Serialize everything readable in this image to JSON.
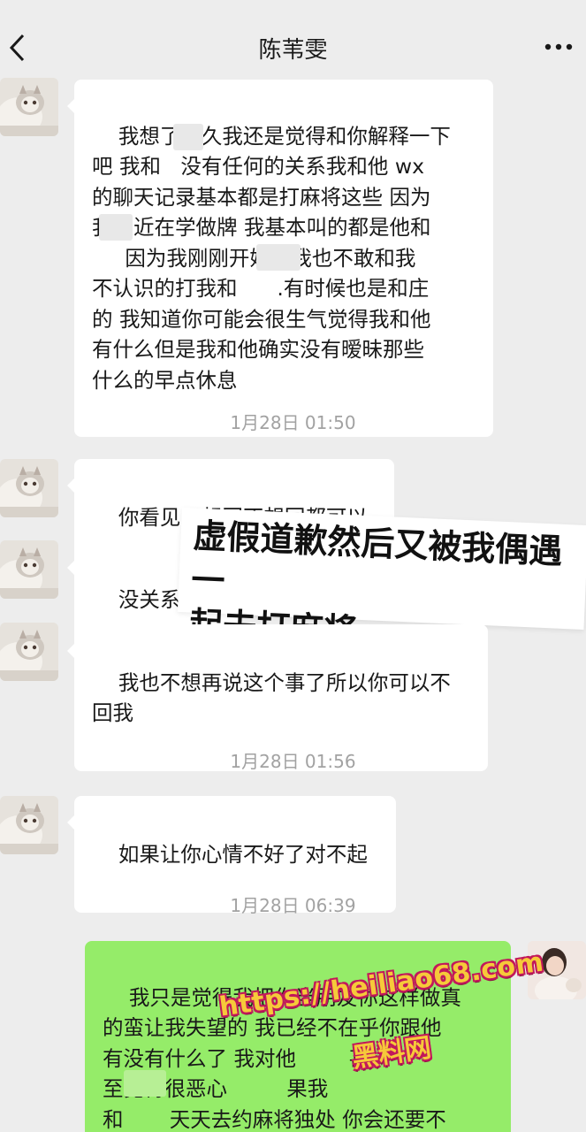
{
  "header": {
    "title": "陈苇雯",
    "back_icon": "chevron-left-icon",
    "more_icon": "more-dots-icon"
  },
  "messages": [
    {
      "direction": "in",
      "text": "我想了很久我还是觉得和你解释一下\n吧 我和   没有任何的关系我和他 wx\n的聊天记录基本都是打麻将这些 因为\n我最近在学做牌 我基本叫的都是他和\n     因为我刚刚开始玩我也不敢和我\n不认识的打我和      .有时候也是和庄\n的 我知道你可能会很生气觉得我和他\n有什么但是我和他确实没有暧昧那些\n什么的早点休息"
    },
    {
      "direction": "in",
      "text": "你看见了想回不想回都可以"
    },
    {
      "direction": "in",
      "text": "没关系"
    },
    {
      "direction": "in",
      "text": "我也不想再说这个事了所以你可以不\n回我"
    },
    {
      "direction": "in",
      "text": "如果让你心情不好了对不起"
    },
    {
      "direction": "out",
      "text": "我只是觉得我把你当朋友你这样做真\n的蛮让我失望的 我已经不在乎你跟他\n有没有什么了 我对他        甚\n至觉得很恶心         果我\n和       天天去约麻将独处 你会还要不\n要我这个朋友"
    }
  ],
  "timestamps": [
    "1月28日 01:50",
    "1月28日 01:56",
    "1月28日 06:39"
  ],
  "annotation": {
    "text": "虚假道歉然后又被我偶遇一\n起去打麻将"
  },
  "watermark": {
    "url": "https://heiliao68.com",
    "name": "黑料网"
  },
  "colors": {
    "background": "#ededed",
    "incoming_bubble": "#ffffff",
    "outgoing_bubble": "#95ec69",
    "timestamp": "#a2a2a2",
    "watermark_fill": "#f6c93a",
    "watermark_stroke": "#c2185b"
  }
}
